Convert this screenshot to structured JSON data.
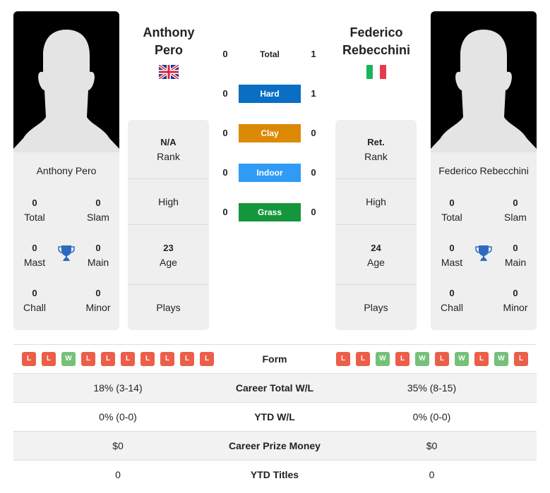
{
  "colors": {
    "hard": "#0a6ec4",
    "clay": "#dc8a06",
    "indoor": "#2f9bf4",
    "grass": "#14963c",
    "loss": "#ec5e47",
    "win": "#76c07a",
    "trophy": "#2e6bbf"
  },
  "player1": {
    "name_line1": "Anthony",
    "name_line2": "Pero",
    "full_name": "Anthony Pero",
    "flag": "uk-flag",
    "titles": {
      "total": "0",
      "total_label": "Total",
      "slam": "0",
      "slam_label": "Slam",
      "mast": "0",
      "mast_label": "Mast",
      "main": "0",
      "main_label": "Main",
      "chall": "0",
      "chall_label": "Chall",
      "minor": "0",
      "minor_label": "Minor"
    },
    "rank_value": "N/A",
    "rank_label": "Rank",
    "high_label": "High",
    "age_value": "23",
    "age_label": "Age",
    "plays_label": "Plays",
    "form": [
      "L",
      "L",
      "W",
      "L",
      "L",
      "L",
      "L",
      "L",
      "L",
      "L"
    ],
    "career_wl": "18% (3-14)",
    "ytd_wl": "0% (0-0)",
    "prize_money": "$0",
    "ytd_titles": "0"
  },
  "player2": {
    "name_line1": "Federico",
    "name_line2": "Rebecchini",
    "full_name": "Federico Rebecchini",
    "flag": "italy-flag",
    "titles": {
      "total": "0",
      "total_label": "Total",
      "slam": "0",
      "slam_label": "Slam",
      "mast": "0",
      "mast_label": "Mast",
      "main": "0",
      "main_label": "Main",
      "chall": "0",
      "chall_label": "Chall",
      "minor": "0",
      "minor_label": "Minor"
    },
    "rank_value": "Ret.",
    "rank_label": "Rank",
    "high_label": "High",
    "age_value": "24",
    "age_label": "Age",
    "plays_label": "Plays",
    "form": [
      "L",
      "L",
      "W",
      "L",
      "W",
      "L",
      "W",
      "L",
      "W",
      "L"
    ],
    "career_wl": "35% (8-15)",
    "ytd_wl": "0% (0-0)",
    "prize_money": "$0",
    "ytd_titles": "0"
  },
  "h2h": [
    {
      "label": "Total",
      "p1": "0",
      "p2": "1",
      "color": null
    },
    {
      "label": "Hard",
      "p1": "0",
      "p2": "1",
      "color": "#0a6ec4"
    },
    {
      "label": "Clay",
      "p1": "0",
      "p2": "0",
      "color": "#dc8a06"
    },
    {
      "label": "Indoor",
      "p1": "0",
      "p2": "0",
      "color": "#2f9bf4"
    },
    {
      "label": "Grass",
      "p1": "0",
      "p2": "0",
      "color": "#14963c"
    }
  ],
  "table": {
    "form_label": "Form",
    "career_wl_label": "Career Total W/L",
    "ytd_wl_label": "YTD W/L",
    "prize_label": "Career Prize Money",
    "ytd_titles_label": "YTD Titles"
  }
}
